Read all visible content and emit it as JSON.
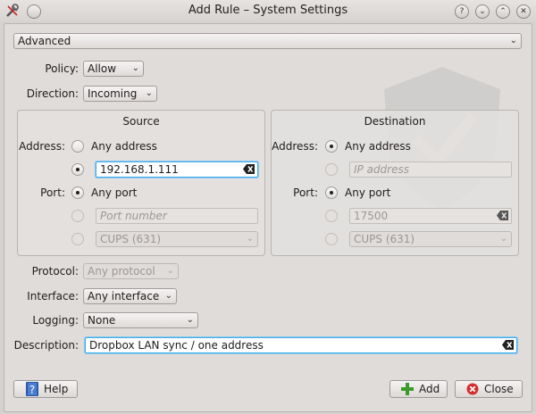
{
  "window": {
    "title": "Add Rule – System Settings",
    "buttons": [
      "?",
      "⌄",
      "⌃",
      "✕"
    ]
  },
  "advanced": {
    "label": "Advanced"
  },
  "policy": {
    "label": "Policy:",
    "value": "Allow"
  },
  "direction": {
    "label": "Direction:",
    "value": "Incoming"
  },
  "source": {
    "title": "Source",
    "address_label": "Address:",
    "any_address": "Any address",
    "address_value": "192.168.1.111",
    "port_label": "Port:",
    "any_port": "Any port",
    "port_placeholder": "Port number",
    "app_value": "CUPS (631)"
  },
  "destination": {
    "title": "Destination",
    "address_label": "Address:",
    "any_address": "Any address",
    "address_placeholder": "IP address",
    "port_label": "Port:",
    "any_port": "Any port",
    "port_value": "17500",
    "app_value": "CUPS (631)"
  },
  "protocol": {
    "label": "Protocol:",
    "value": "Any protocol"
  },
  "interface": {
    "label": "Interface:",
    "value": "Any interface"
  },
  "logging": {
    "label": "Logging:",
    "value": "None"
  },
  "description": {
    "label": "Description:",
    "value": "Dropbox LAN sync / one address"
  },
  "buttons": {
    "help": "Help",
    "add": "Add",
    "close": "Close"
  }
}
